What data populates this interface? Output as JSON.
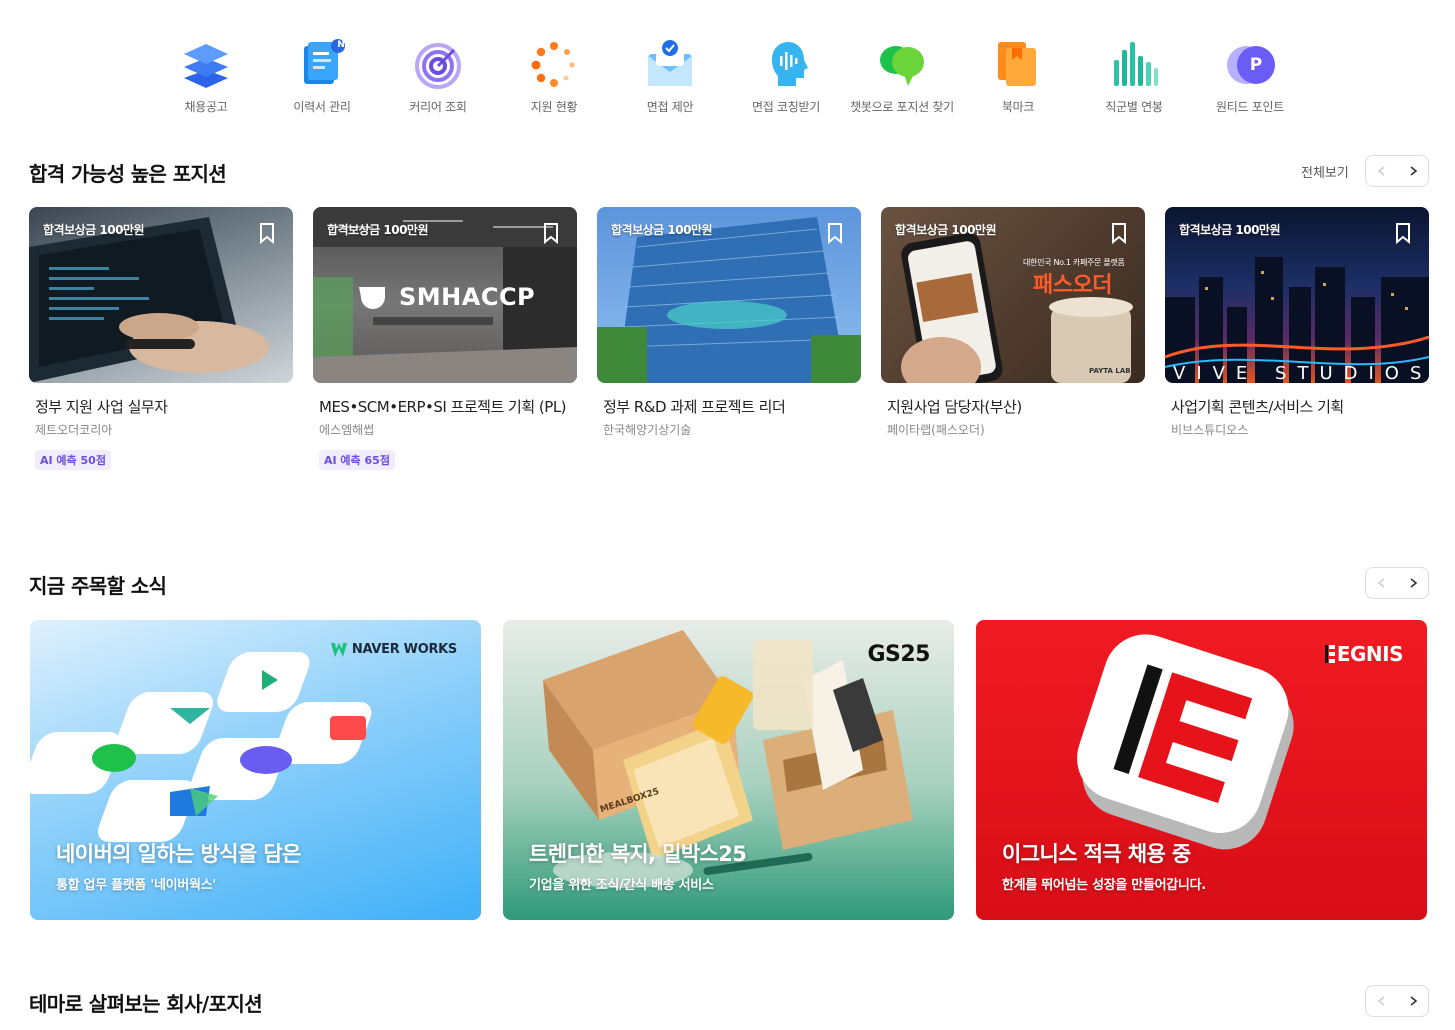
{
  "menu": [
    {
      "label": "채용공고",
      "icon": "layers-icon"
    },
    {
      "label": "이력서 관리",
      "icon": "resume-icon",
      "badge": "N"
    },
    {
      "label": "커리어 조회",
      "icon": "target-icon"
    },
    {
      "label": "지원 현황",
      "icon": "loading-dots-icon"
    },
    {
      "label": "면접 제안",
      "icon": "envelope-icon"
    },
    {
      "label": "면접 코칭받기",
      "icon": "voice-head-icon"
    },
    {
      "label": "챗봇으로 포지션 찾기",
      "icon": "chat-bubble-icon"
    },
    {
      "label": "북마크",
      "icon": "bookmark-folder-icon"
    },
    {
      "label": "직군별 연봉",
      "icon": "bar-chart-icon"
    },
    {
      "label": "원티드 포인트",
      "icon": "point-coin-icon",
      "coin_letter": "P"
    }
  ],
  "positions": {
    "title": "합격 가능성 높은 포지션",
    "see_all": "전체보기",
    "cards": [
      {
        "reward": "합격보상금 100만원",
        "title": "정부 지원 사업 실무자",
        "company": "제트오더코리아",
        "ai_badge": "AI 예측 50점"
      },
      {
        "reward": "합격보상금 100만원",
        "title": "MES•SCM•ERP•SI 프로젝트 기획 (PL)",
        "company": "에스엠해썹",
        "ai_badge": "AI 예측 65점",
        "image_text": "SMHACCP"
      },
      {
        "reward": "합격보상금 100만원",
        "title": "정부 R&D 과제 프로젝트 리더",
        "company": "한국해양기상기술"
      },
      {
        "reward": "합격보상금 100만원",
        "title": "지원사업 담당자(부산)",
        "company": "페이타랩(패스오더)",
        "image_text": "패스오더",
        "image_subtext": "대한민국 No.1 카페주문 플랫폼",
        "image_tag": "PAYTA LAB."
      },
      {
        "reward": "합격보상금 100만원",
        "title": "사업기획 콘텐츠/서비스 기획",
        "company": "비브스튜디오스",
        "image_text": "VIVE STUDIOS"
      }
    ]
  },
  "news": {
    "title": "지금 주목할 소식",
    "banners": [
      {
        "title": "네이버의 일하는 방식을 담은",
        "subtitle": "통합 업무 플랫폼 '네이버웍스'",
        "logo": "NAVER WORKS"
      },
      {
        "title": "트렌디한 복지, 밀박스25",
        "subtitle": "기업을 위한 조식/간식 배송 서비스",
        "logo": "GS25",
        "box_text": "MEALBOX25"
      },
      {
        "title": "이그니스 적극 채용 중",
        "subtitle": "한계를 뛰어넘는 성장을 만들어갑니다.",
        "logo": "EGNIS"
      }
    ]
  },
  "theme": {
    "title": "테마로 살펴보는 회사/포지션"
  },
  "colors": {
    "accent": "#6a4fe0",
    "naver_bg": "#4fb8f5",
    "gs25_bg": "#2e9a78",
    "egnis_bg": "#e6131b"
  }
}
